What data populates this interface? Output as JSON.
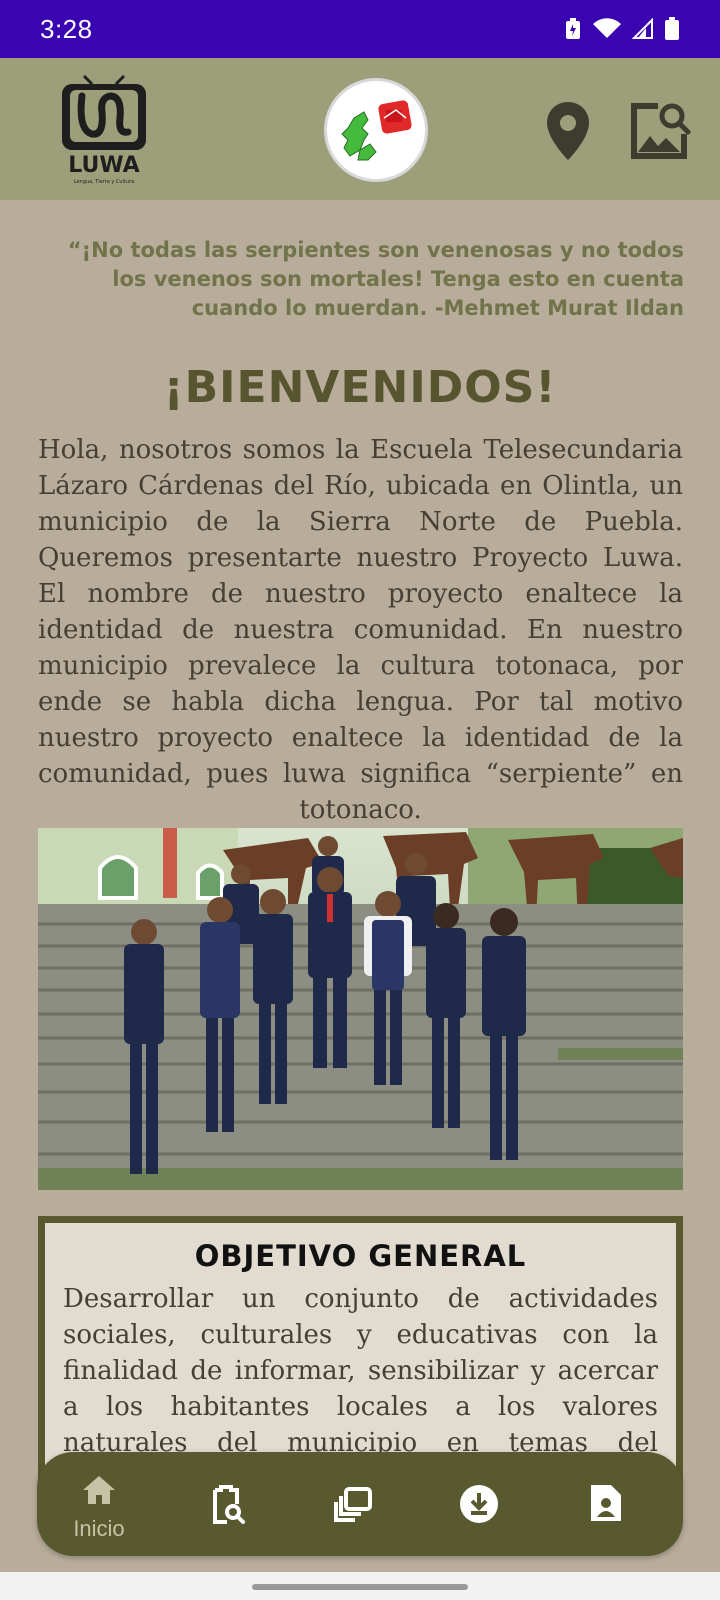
{
  "status_bar": {
    "time": "3:28"
  },
  "header": {
    "logo_text": "LUWA",
    "logo_subtext": "Lengua, Tierra y Cultura",
    "icons": [
      "map-pin-icon",
      "image-search-icon"
    ]
  },
  "quote": "“¡No todas las serpientes son venenosas y no todos los venenos son mortales! Tenga esto en cuenta cuando lo muerdan. -Mehmet Murat Ildan",
  "welcome_title": "¡BIENVENIDOS!",
  "intro_text": "Hola, nosotros somos la Escuela Telesecundaria Lázaro Cárdenas del Río, ubicada en Olintla, un municipio de la Sierra Norte de Puebla. Queremos presentarte nuestro Proyecto Luwa. El nombre de nuestro proyecto enaltece la identidad de nuestra comunidad. En nuestro municipio prevalece la cultura totonaca, por ende se habla dicha lengua. Por tal motivo nuestro proyecto enaltece la identidad de la comunidad, pues luwa significa “serpiente” en totonaco.",
  "objective": {
    "title": "OBJETIVO GENERAL",
    "text": "Desarrollar un conjunto de actividades sociales, culturales y educativas con la finalidad de informar, sensibilizar y acercar a los habitantes locales a los valores naturales del municipio en temas del cuidado de los ofidios."
  },
  "bottom_nav": {
    "items": [
      {
        "icon": "home-icon",
        "label": "Inicio",
        "active": true
      },
      {
        "icon": "clipboard-search-icon",
        "label": ""
      },
      {
        "icon": "gallery-icon",
        "label": ""
      },
      {
        "icon": "download-icon",
        "label": ""
      },
      {
        "icon": "document-icon",
        "label": ""
      }
    ]
  },
  "colors": {
    "status_bar": "#3a05b0",
    "header": "#9d9f7b",
    "background": "#b8ad9b",
    "accent": "#58592e",
    "quote": "#71734b"
  }
}
